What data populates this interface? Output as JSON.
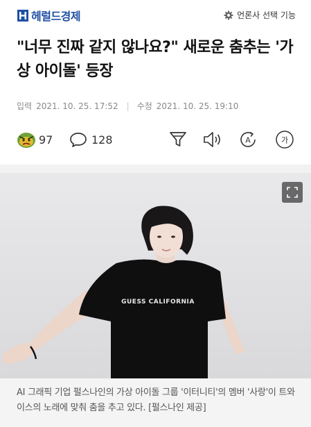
{
  "header": {
    "brand": "헤럴드경제",
    "brand_color": "#1f4fa3",
    "settings_label": "언론사 선택 기능",
    "settings_icon": "gear-icon"
  },
  "article": {
    "title": "\"너무 진짜 같지 않나요?\" 새로운 춤추는 '가상 아이돌' 등장",
    "published_label": "입력",
    "published": "2021. 10. 25. 17:52",
    "modified_label": "수정",
    "modified": "2021. 10. 25. 19:10"
  },
  "actions": {
    "reaction_icon": "angry-face-emoji",
    "reaction_count": "97",
    "comment_icon": "speech-bubble-icon",
    "comment_count": "128",
    "summary_icon": "funnel-icon",
    "tts_icon": "speaker-icon",
    "translate_icon": "translate-icon",
    "translate_glyph": "A",
    "font_icon": "font-size-icon",
    "font_glyph": "가"
  },
  "photo": {
    "shirt_text": "GUESS CALIFORNIA",
    "caption": "AI 그래픽 기업 펄스나인의 가상 아이돌 그룹 '이터니티'의 멤버 '사랑'이 트와이스의 노래에 맞춰 춤을 추고 있다. [펄스나인 제공]"
  }
}
